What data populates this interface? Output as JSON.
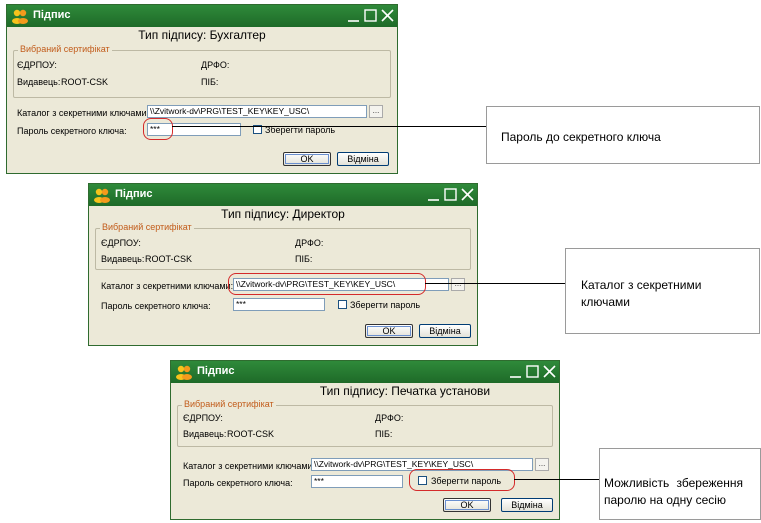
{
  "dialogs": [
    {
      "app_title": "Підпис",
      "subtitle": "Тип підпису: Бухгалтер",
      "cert_group_label": "Вибраний сертифікат",
      "edrpou_label": "ЄДРПОУ:",
      "drfo_label": "ДРФО:",
      "issuer_label": "Видавець:",
      "issuer_value": "ROOT-CSK",
      "pib_label": "ПІБ:",
      "catalog_label": "Каталог з секретними ключами:",
      "catalog_value": "\\\\Zvitwork-dv\\PRG\\TEST_KEY\\KEY_USC\\",
      "browse_label": "...",
      "password_label": "Пароль секретного ключа:",
      "password_value": "***",
      "save_password_label": "Зберегти пароль",
      "ok_label": "OK",
      "cancel_label": "Відміна"
    },
    {
      "app_title": "Підпис",
      "subtitle": "Тип підпису: Директор",
      "cert_group_label": "Вибраний сертифікат",
      "edrpou_label": "ЄДРПОУ:",
      "drfo_label": "ДРФО:",
      "issuer_label": "Видавець:",
      "issuer_value": "ROOT-CSK",
      "pib_label": "ПІБ:",
      "catalog_label": "Каталог з секретними ключами:",
      "catalog_value": "\\\\Zvitwork-dv\\PRG\\TEST_KEY\\KEY_USC\\",
      "browse_label": "...",
      "password_label": "Пароль секретного ключа:",
      "password_value": "***",
      "save_password_label": "Зберегти пароль",
      "ok_label": "OK",
      "cancel_label": "Відміна"
    },
    {
      "app_title": "Підпис",
      "subtitle": "Тип підпису: Печатка установи",
      "cert_group_label": "Вибраний сертифікат",
      "edrpou_label": "ЄДРПОУ:",
      "drfo_label": "ДРФО:",
      "issuer_label": "Видавець:",
      "issuer_value": "ROOT-CSK",
      "pib_label": "ПІБ:",
      "catalog_label": "Каталог з секретними ключами:",
      "catalog_value": "\\\\Zvitwork-dv\\PRG\\TEST_KEY\\KEY_USC\\",
      "browse_label": "...",
      "password_label": "Пароль секретного ключа:",
      "password_value": "***",
      "save_password_label": "Зберегти пароль",
      "ok_label": "OK",
      "cancel_label": "Відміна"
    }
  ],
  "callouts": [
    {
      "text": "Пароль до секретного ключа"
    },
    {
      "line1": "Каталог з секретними",
      "line2": "ключами"
    },
    {
      "line1": "Можливість збереження",
      "line2": "паролю на одну сесію"
    }
  ],
  "colors": {
    "titlebar": "#2f8a3a",
    "dialog_bg": "#ece9d8",
    "highlight": "#d42a2a",
    "group_label": "#c25c1b"
  },
  "icons": {
    "app": "people-icon",
    "minimize": "minimize-icon",
    "maximize": "maximize-icon",
    "close": "close-icon"
  }
}
